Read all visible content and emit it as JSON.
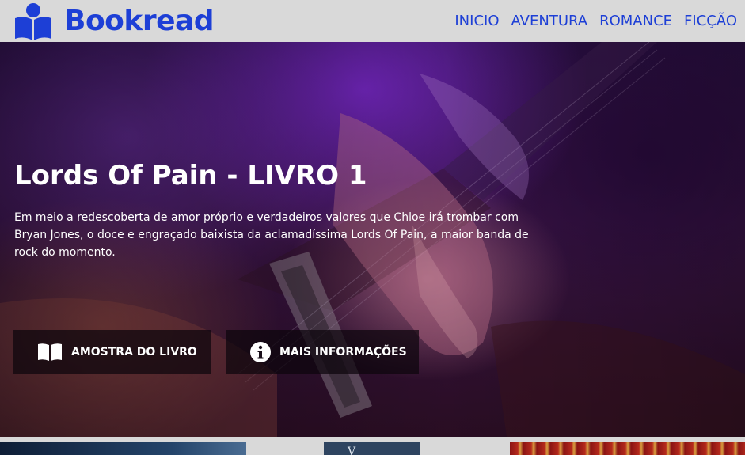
{
  "header": {
    "brand": "Bookread",
    "logo_icon": "reader-book-icon",
    "brand_color": "#1d3fd6",
    "nav": [
      {
        "label": "INICIO"
      },
      {
        "label": "AVENTURA"
      },
      {
        "label": "ROMANCE"
      },
      {
        "label": "FICÇÃO"
      }
    ]
  },
  "hero": {
    "title": "Lords Of Pain - LIVRO 1",
    "description": "Em meio a redescoberta de amor próprio e verdadeiros valores que Chloe irá trombar com Bryan Jones, o doce e engraçado baixista da aclamadíssima Lords Of Pain, a maior banda de rock do momento.",
    "image_subject": "guitarist-hands-purple-stage-light",
    "buttons": [
      {
        "label": "AMOSTRA DO LIVRO",
        "icon": "open-book-icon"
      },
      {
        "label": "MAIS INFORMAÇÕES",
        "icon": "info-circle-icon"
      }
    ]
  },
  "thumbnails": {
    "items": [
      {
        "icon": "book-cover-thumbnail"
      },
      {
        "icon": "book-cover-thumbnail",
        "text": "V"
      },
      {
        "icon": "book-cover-thumbnail"
      }
    ]
  }
}
